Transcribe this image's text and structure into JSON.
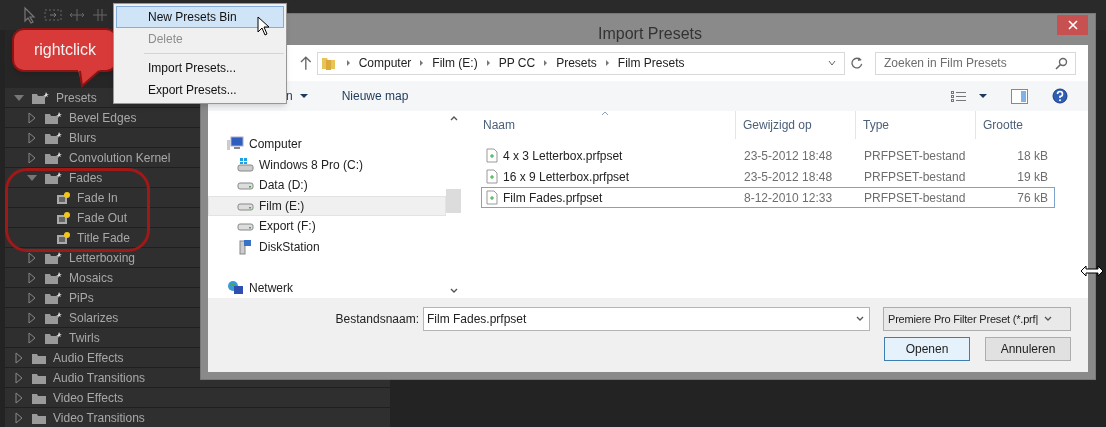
{
  "context_menu": {
    "items": [
      {
        "label": "New Presets Bin",
        "selected": true,
        "disabled": false
      },
      {
        "label": "Delete",
        "selected": false,
        "disabled": true
      },
      {
        "kind": "separator"
      },
      {
        "label": "Import Presets...",
        "selected": false,
        "disabled": false
      },
      {
        "label": "Export Presets...",
        "selected": false,
        "disabled": false
      }
    ]
  },
  "callout": {
    "text": "rightclick"
  },
  "effects_tree": [
    {
      "label": "Presets",
      "kind": "bin",
      "expanded": true,
      "children": [
        {
          "label": "Bevel Edges",
          "kind": "bin",
          "expanded": false
        },
        {
          "label": "Blurs",
          "kind": "bin",
          "expanded": false
        },
        {
          "label": "Convolution Kernel",
          "kind": "bin",
          "expanded": false
        },
        {
          "label": "Fades",
          "kind": "bin",
          "expanded": true,
          "children": [
            {
              "label": "Fade In",
              "kind": "preset"
            },
            {
              "label": "Fade Out",
              "kind": "preset"
            },
            {
              "label": "Title Fade",
              "kind": "preset"
            }
          ]
        },
        {
          "label": "Letterboxing",
          "kind": "bin",
          "expanded": false
        },
        {
          "label": "Mosaics",
          "kind": "bin",
          "expanded": false
        },
        {
          "label": "PiPs",
          "kind": "bin",
          "expanded": false
        },
        {
          "label": "Solarizes",
          "kind": "bin",
          "expanded": false
        },
        {
          "label": "Twirls",
          "kind": "bin",
          "expanded": false
        }
      ]
    },
    {
      "label": "Audio Effects",
      "kind": "folder",
      "expanded": false
    },
    {
      "label": "Audio Transitions",
      "kind": "folder",
      "expanded": false
    },
    {
      "label": "Video Effects",
      "kind": "folder",
      "expanded": false
    },
    {
      "label": "Video Transitions",
      "kind": "folder",
      "expanded": false
    }
  ],
  "dialog": {
    "title": "Import Presets",
    "breadcrumb": [
      "Computer",
      "Film (E:)",
      "PP CC",
      "Presets",
      "Film Presets"
    ],
    "search": {
      "placeholder": "Zoeken in Film Presets"
    },
    "toolbar": {
      "organize": "n",
      "new_folder": "Nieuwe map"
    },
    "nav": [
      {
        "label": "Computer",
        "kind": "computer",
        "selected": false,
        "children": [
          {
            "label": "Windows 8 Pro (C:)",
            "kind": "system-drive",
            "selected": false
          },
          {
            "label": "Data (D:)",
            "kind": "drive",
            "selected": false
          },
          {
            "label": "Film (E:)",
            "kind": "drive",
            "selected": true
          },
          {
            "label": "Export (F:)",
            "kind": "drive",
            "selected": false
          },
          {
            "label": "DiskStation",
            "kind": "network-drive",
            "selected": false
          }
        ]
      },
      {
        "label": "Netwerk",
        "kind": "network",
        "selected": false
      }
    ],
    "columns": [
      "Naam",
      "Gewijzigd op",
      "Type",
      "Grootte"
    ],
    "files": [
      {
        "name": "4 x 3 Letterbox.prfpset",
        "modified": "23-5-2012 18:48",
        "type": "PRFPSET-bestand",
        "size": "18 kB",
        "selected": false
      },
      {
        "name": "16 x 9 Letterbox.prfpset",
        "modified": "23-5-2012 18:48",
        "type": "PRFPSET-bestand",
        "size": "19 kB",
        "selected": false
      },
      {
        "name": "Film Fades.prfpset",
        "modified": "8-12-2010 12:33",
        "type": "PRFPSET-bestand",
        "size": "76 kB",
        "selected": true
      }
    ],
    "filename_label": "Bestandsnaam:",
    "filename": "Film Fades.prfpset",
    "filter": "Premiere Pro Filter Preset (*.prf|",
    "buttons": [
      {
        "label": "Openen",
        "kind": "primary"
      },
      {
        "label": "Annuleren",
        "kind": "secondary"
      }
    ]
  }
}
